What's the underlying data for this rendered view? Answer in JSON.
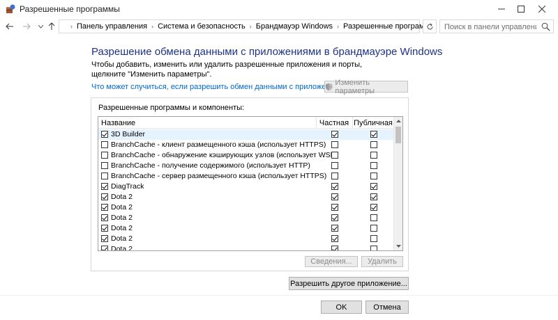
{
  "window": {
    "title": "Разрешенные программы"
  },
  "address_bar": {
    "breadcrumbs": [
      "Панель управления",
      "Система и безопасность",
      "Брандмауэр Windows",
      "Разрешенные программы"
    ],
    "search_placeholder": "Поиск в панели управления"
  },
  "content": {
    "heading": "Разрешение обмена данными с приложениями в брандмауэре Windows",
    "description": "Чтобы добавить, изменить или удалить разрешенные приложения и порты, щелкните \"Изменить параметры\".",
    "risk_link": "Что может случиться, если разрешить обмен данными с приложением?",
    "change_settings_label": "Изменить параметры"
  },
  "apps_group": {
    "label": "Разрешенные программы и компоненты:",
    "columns": {
      "name": "Название",
      "private": "Частная",
      "public": "Публичная"
    },
    "rows": [
      {
        "name": "3D Builder",
        "enabled": true,
        "private": true,
        "public": true,
        "selected": true
      },
      {
        "name": "BranchCache - клиент размещенного кэша (использует HTTPS)",
        "enabled": false,
        "private": false,
        "public": false
      },
      {
        "name": "BranchCache - обнаружение кэширующих узлов (использует WSD)",
        "enabled": false,
        "private": false,
        "public": false
      },
      {
        "name": "BranchCache - получение содержимого (использует HTTP)",
        "enabled": false,
        "private": false,
        "public": false
      },
      {
        "name": "BranchCache - сервер размещенного кэша (использует HTTPS)",
        "enabled": false,
        "private": false,
        "public": false
      },
      {
        "name": "DiagTrack",
        "enabled": true,
        "private": true,
        "public": true
      },
      {
        "name": "Dota 2",
        "enabled": true,
        "private": true,
        "public": true
      },
      {
        "name": "Dota 2",
        "enabled": true,
        "private": true,
        "public": true
      },
      {
        "name": "Dota 2",
        "enabled": true,
        "private": true,
        "public": false
      },
      {
        "name": "Dota 2",
        "enabled": true,
        "private": true,
        "public": false
      },
      {
        "name": "Dota 2",
        "enabled": true,
        "private": true,
        "public": false
      },
      {
        "name": "Dota 2",
        "enabled": true,
        "private": true,
        "public": false
      }
    ],
    "details_label": "Сведения...",
    "delete_label": "Удалить"
  },
  "allow_other_label": "Разрешить другое приложение...",
  "footer": {
    "ok_label": "OK",
    "cancel_label": "Отмена"
  },
  "colors": {
    "heading": "#1e3287",
    "link": "#0066cc",
    "selection": "#e5f3ff"
  }
}
